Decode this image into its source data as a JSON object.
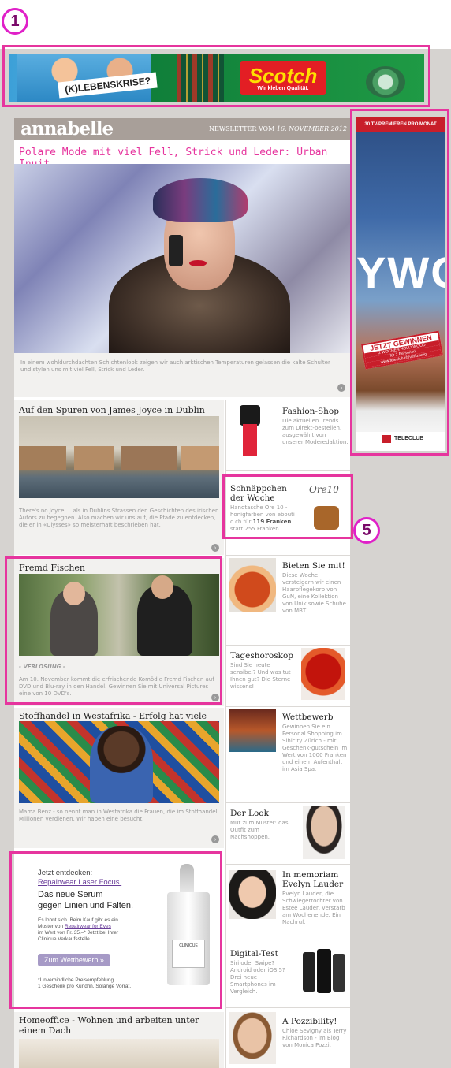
{
  "markers": [
    "1",
    "5"
  ],
  "top_banner": {
    "tagline": "(K)LEBENSKRISE?",
    "brand": "Scotch",
    "brand_tag": "Wir kleben Qualität."
  },
  "newsletter": {
    "logo": "annabelle",
    "date_prefix": "NEWSLETTER VOM",
    "date": "16. NOVEMBER 2012"
  },
  "hero": {
    "title": "Polare Mode mit viel Fell, Strick und Leder: Urban Inuit",
    "text": "In einem wohldurchdachten Schichtenlook zeigen wir auch arktischen Temperaturen gelassen die kalte Schulter und stylen uns mit viel Fell, Strick und Leder."
  },
  "articles": [
    {
      "title": "Auf den Spuren von James Joyce in Dublin",
      "text": "There's no Joyce ... als in Dublins Strassen den Geschichten des irischen Autors zu begegnen. Also machen wir uns auf, die Pfade zu entdecken, die er in «Ulysses» so meisterhaft beschrieben hat."
    },
    {
      "title": "Fremd Fischen",
      "kicker": "- VERLOSUNG -",
      "text": "Am 10. November kommt die erfrischende Komödie Fremd Fischen auf DVD und Blu-ray in den Handel. Gewinnen Sie mit Universal Pictures eine von 10 DVD's."
    },
    {
      "title": "Stoffhandel in Westafrika - Erfolg hat viele Muster",
      "text": "Mama Benz - so nennt man in Westafrika die Frauen, die im Stoffhandel Millionen verdienen. Wir haben eine besucht."
    },
    {
      "title": "Homeoffice - Wohnen und arbeiten unter einem Dach"
    }
  ],
  "clinique_ad": {
    "line1": "Jetzt entdecken:",
    "product_link": "Repairwear Laser Focus.",
    "line2": "Das neue Serum",
    "line3": "gegen Linien und Falten.",
    "body1": "Es lohnt sich. Beim Kauf gibt es ein",
    "body2": "Muster von",
    "body_link": "Repairwear for Eyes",
    "body3": "im Wert von Fr. 35.–* Jetzt bei Ihrer",
    "body4": "Clinique Verkaufsstelle.",
    "button": "Zum Wettbewerb »",
    "foot1": "*Unverbindliche Preisempfehlung.",
    "foot2": "1 Geschenk pro Kund/in. Solange Vorrat.",
    "bottle_label": "CLINIQUE"
  },
  "sidebar": [
    {
      "title": "Fashion-Shop",
      "text": "Die aktuellen Trends zum Direkt-bestellen, ausgewählt von unserer Moderedaktion."
    },
    {
      "title": "Schnäppchen der Woche",
      "text_pre": "Handtasche Ore 10 - honigfarben von ebouti c.ch für",
      "price": "119 Franken",
      "text_post": "statt 255 Franken.",
      "brand": "Ore10"
    },
    {
      "title": "Bieten Sie mit!",
      "text": "Diese Woche versteigern wir einen Haarpflegekorb von GuN, eine Kollektion von Unik sowie Schuhe von MBT."
    },
    {
      "title": "Tageshoroskop",
      "text": "Sind Sie heute sensibel? Und was tut Ihnen gut? Die Sterne wissens!"
    },
    {
      "title": "Wettbewerb",
      "text": "Gewinnen Sie ein Personal Shopping im Sihlcity Zürich - mit Geschenk-gutschein im Wert von 1000 Franken und einem Aufenthalt im Asia Spa."
    },
    {
      "title": "Der Look",
      "text": "Mut zum Muster: das Outfit zum Nachshoppen."
    },
    {
      "title": "In memoriam Evelyn Lauder",
      "text": "Evelyn Lauder, die Schwiegertochter von Estée Lauder, verstarb am Wochenende. Ein Nachruf."
    },
    {
      "title": "Digital-Test",
      "text": "Siri oder Swipe? Android oder iOS 5? Drei neue Smartphones im Vergleich."
    },
    {
      "title": "A Pozzibility!",
      "text": "Chloe Sevigny als Terry Richardson - im Blog von Monica Pozzi."
    }
  ],
  "tv_ad": {
    "top": "30 TV-PREMIEREN PRO MONAT",
    "big": "YWO",
    "win": "JETZT GEWINNEN",
    "win_sub1": "2 WOCHEN HOLLYWOOD",
    "win_sub2": "für 2 Personen",
    "win_url": "www.teleclub.ch/verlosung",
    "brand": "TELECLUB"
  }
}
